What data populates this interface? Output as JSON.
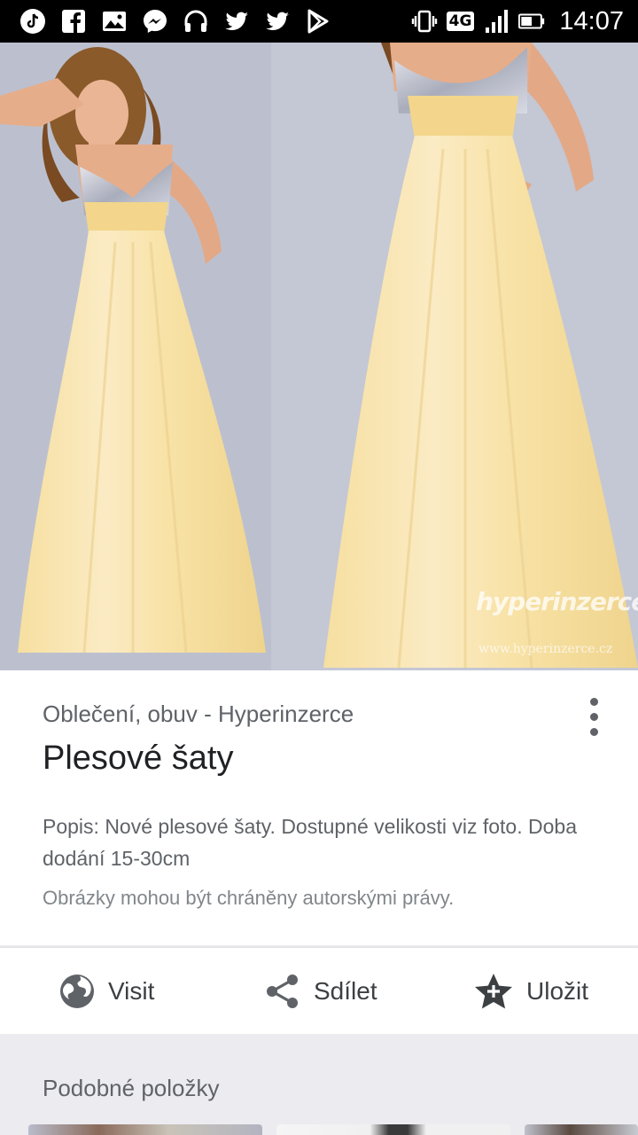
{
  "status_bar": {
    "left_icons": [
      "tiktok-icon",
      "facebook-icon",
      "gallery-icon",
      "messenger-icon",
      "headphones-icon",
      "twitter-icon",
      "twitter-icon",
      "play-store-icon"
    ],
    "network_type": "4G",
    "time": "14:07"
  },
  "hero": {
    "watermark": "hyperinzerce",
    "watermark_url": "www.hyperinzerce.cz"
  },
  "result": {
    "source": "Oblečení, obuv - Hyperinzerce",
    "title": "Plesové šaty",
    "description": "Popis: Nové plesové šaty. Dostupné velikosti viz foto. Doba dodání 15-30cm",
    "copyright_notice": "Obrázky mohou být chráněny autorskými právy."
  },
  "actions": {
    "visit_label": "Visit",
    "share_label": "Sdílet",
    "save_label": "Uložit"
  },
  "similar": {
    "heading": "Podobné položky"
  },
  "colors": {
    "status_bar_bg": "#000000",
    "card_bg": "#ffffff",
    "page_bg": "#ecebf0",
    "icon_gray": "#5f6368",
    "dress_yellow": "#f7e3a4"
  }
}
